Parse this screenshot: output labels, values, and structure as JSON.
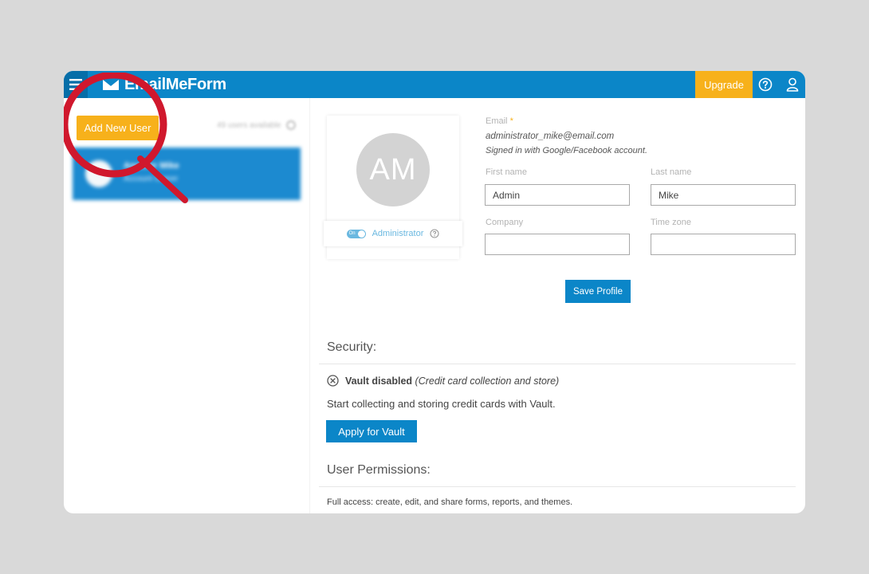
{
  "header": {
    "brand": "EmailMeForm",
    "upgrade_label": "Upgrade",
    "help_icon": "question-circle-icon",
    "user_icon": "user-icon",
    "menu_icon": "hamburger-icon"
  },
  "sidebar": {
    "add_user_label": "Add New User",
    "users_available": "49 users available",
    "users": [
      {
        "name": "Another Mike",
        "role": "Account Owner"
      }
    ]
  },
  "profile": {
    "initials": "AM",
    "admin_toggle_text": "On",
    "admin_label": "Administrator",
    "email_label": "Email",
    "email_required_mark": "*",
    "email_value": "administrator_mike@email.com",
    "signed_in_note": "Signed in with Google/Facebook account.",
    "first_name_label": "First name",
    "first_name_value": "Admin",
    "last_name_label": "Last name",
    "last_name_value": "Mike",
    "company_label": "Company",
    "company_value": "",
    "timezone_label": "Time zone",
    "timezone_value": "",
    "save_label": "Save Profile"
  },
  "security": {
    "title": "Security:",
    "vault_status_bold": "Vault disabled",
    "vault_status_note": "(Credit card collection and store)",
    "vault_description": "Start collecting and storing credit cards with Vault.",
    "vault_button": "Apply for Vault"
  },
  "permissions": {
    "title": "User Permissions:",
    "description": "Full access: create, edit, and share forms, reports, and themes."
  },
  "colors": {
    "brand_blue": "#0b86c8",
    "accent_yellow": "#f7b11b",
    "magnifier_red": "#d0182d"
  }
}
